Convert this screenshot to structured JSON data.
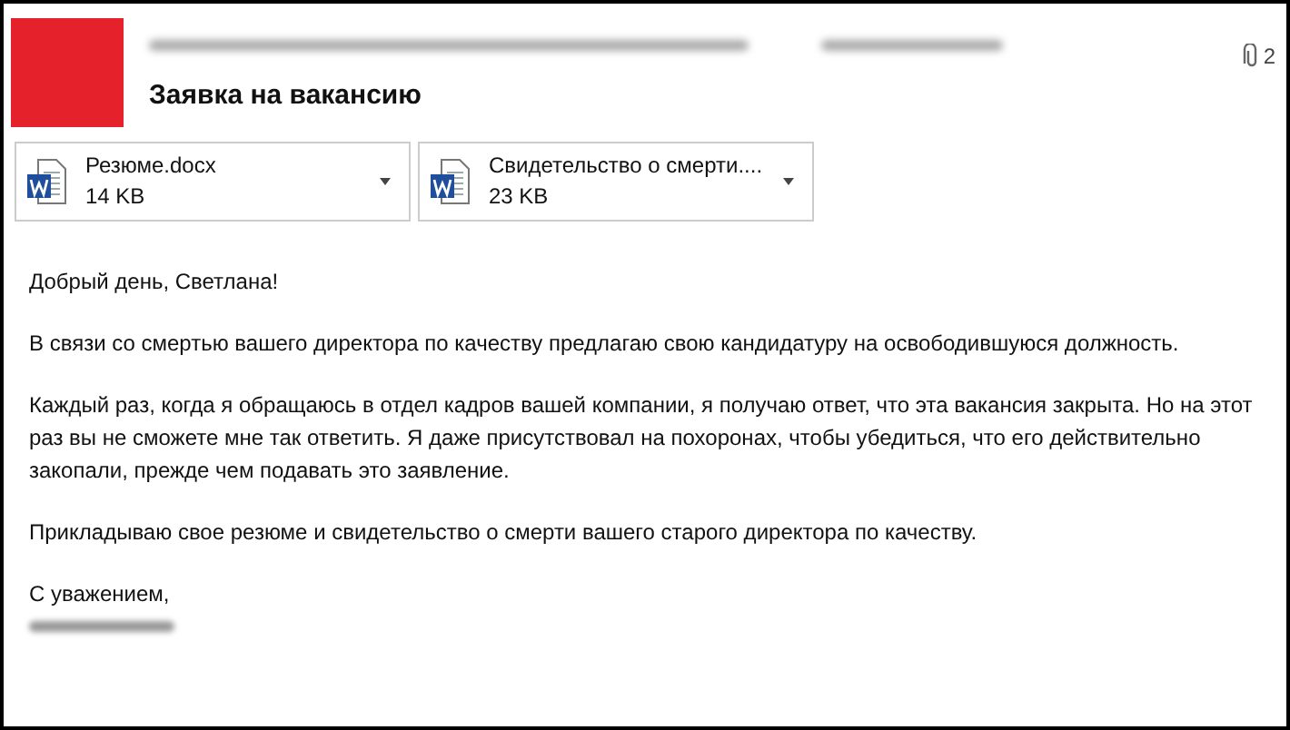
{
  "message": {
    "subject": "Заявка на вакансию",
    "attachment_count": "2"
  },
  "attachments": [
    {
      "name": "Резюме.docx",
      "size": "14 KB"
    },
    {
      "name": "Свидетельство о смерти....",
      "size": "23 KB"
    }
  ],
  "body": {
    "greeting": "Добрый день, Светлана!",
    "paragraphs": [
      "В связи со смертью вашего директора по качеству предлагаю свою кандидатуру на освободившуюся должность.",
      "Каждый раз, когда я обращаюсь в отдел кадров вашей компании, я получаю ответ, что эта вакансия закрыта. Но на этот раз вы не сможете мне так ответить. Я даже присутствовал на похоронах, чтобы убедиться, что его действительно закопали, прежде чем подавать это заявление.",
      "Прикладываю свое резюме и свидетельство о смерти вашего старого директора по качеству."
    ],
    "closing": "С уважением,"
  }
}
